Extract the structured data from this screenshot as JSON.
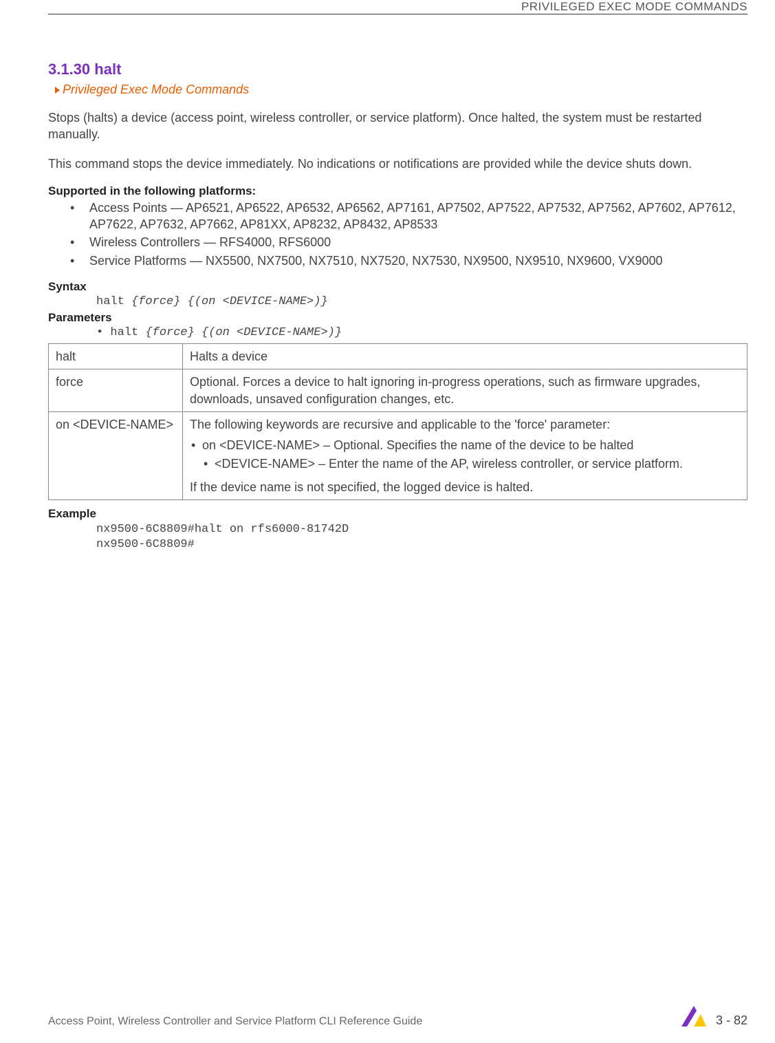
{
  "header": {
    "title": "PRIVILEGED EXEC MODE COMMANDS"
  },
  "section": {
    "number_title": "3.1.30 halt",
    "link_text": "Privileged Exec Mode Commands"
  },
  "paragraphs": {
    "p1": "Stops (halts) a device (access point, wireless controller, or service platform). Once halted, the system must be restarted manually.",
    "p2": "This command stops the device immediately. No indications or notifications are provided while the device shuts down."
  },
  "supported": {
    "heading": "Supported in the following platforms:",
    "items": [
      "Access Points — AP6521, AP6522, AP6532, AP6562, AP7161, AP7502, AP7522, AP7532, AP7562, AP7602, AP7612, AP7622, AP7632, AP7662, AP81XX, AP8232, AP8432, AP8533",
      "Wireless Controllers — RFS4000, RFS6000",
      "Service Platforms — NX5500, NX7500, NX7510, NX7520, NX7530, NX9500, NX9510, NX9600, VX9000"
    ]
  },
  "syntax": {
    "heading": "Syntax",
    "code_prefix": "halt ",
    "code_italic": "{force} {(on <DEVICE-NAME>)}"
  },
  "parameters": {
    "heading": "Parameters",
    "code_prefix": "• halt ",
    "code_italic": "{force} {(on <DEVICE-NAME>)}",
    "table": [
      {
        "name": "halt",
        "desc_main": "Halts a device"
      },
      {
        "name": "force",
        "desc_main": "Optional. Forces a device to halt ignoring in-progress operations, such as firmware upgrades, downloads, unsaved configuration changes, etc."
      },
      {
        "name": "on <DEVICE-NAME>",
        "desc_main": "The following keywords are recursive and applicable to the 'force' parameter:",
        "bullet1": "on <DEVICE-NAME> – Optional. Specifies the name of the device to be halted",
        "bullet1_sub": "<DEVICE-NAME> – Enter the name of the AP, wireless controller, or service platform.",
        "desc_tail": "If the device name is not specified, the logged device is halted."
      }
    ]
  },
  "example": {
    "heading": "Example",
    "code": "nx9500-6C8809#halt on rfs6000-81742D\nnx9500-6C8809#"
  },
  "footer": {
    "text": "Access Point, Wireless Controller and Service Platform CLI Reference Guide",
    "page": "3 - 82"
  }
}
